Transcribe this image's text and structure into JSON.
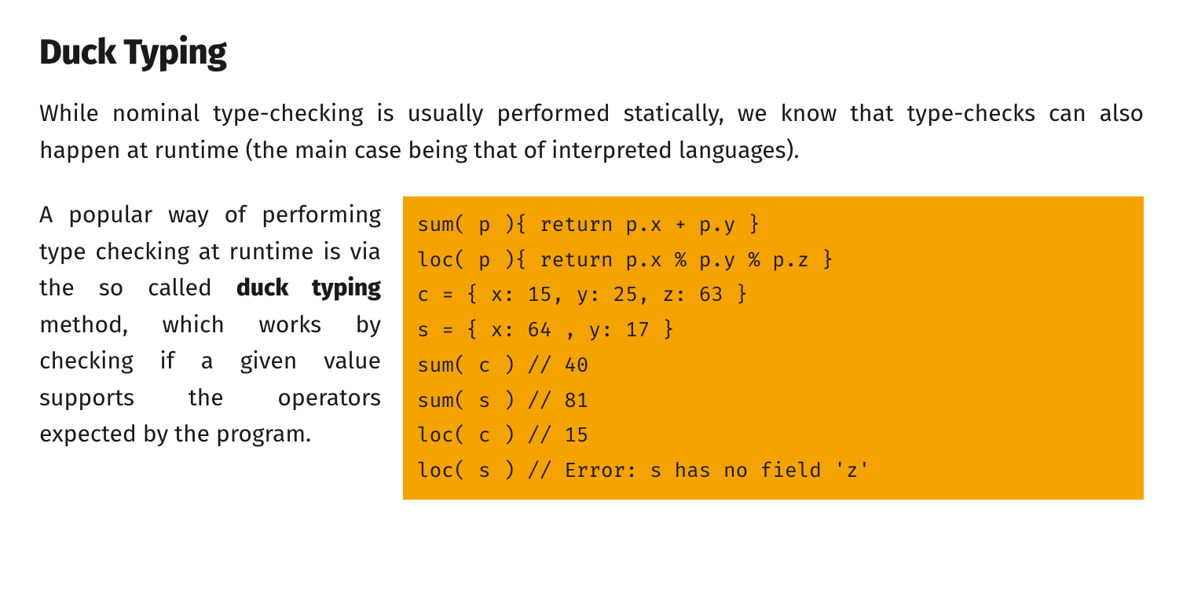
{
  "heading": "Duck Typing",
  "paragraph1": "While nominal type-checking is usually performed statically, we know that type-checks can also happen at runtime (the main case being that of interpreted languages).",
  "paragraph2_pre": "A popular way of performing type checking at runtime is via the so called ",
  "paragraph2_bold": "duck typing",
  "paragraph2_post": " method, which works by checking if a given value supports the operators expected by the program.",
  "code": {
    "line1": "sum( p ){ return p.x + p.y }",
    "line2": "loc( p ){ return p.x % p.y % p.z }",
    "line3": "c = { x: 15, y: 25, z: 63 }",
    "line4": "s = { x: 64 , y: 17 }",
    "line5": "sum( c ) // 40",
    "line6": "sum( s ) // 81",
    "line7": "loc( c ) // 15",
    "line8": "loc( s ) // Error: s has no field 'z'"
  }
}
